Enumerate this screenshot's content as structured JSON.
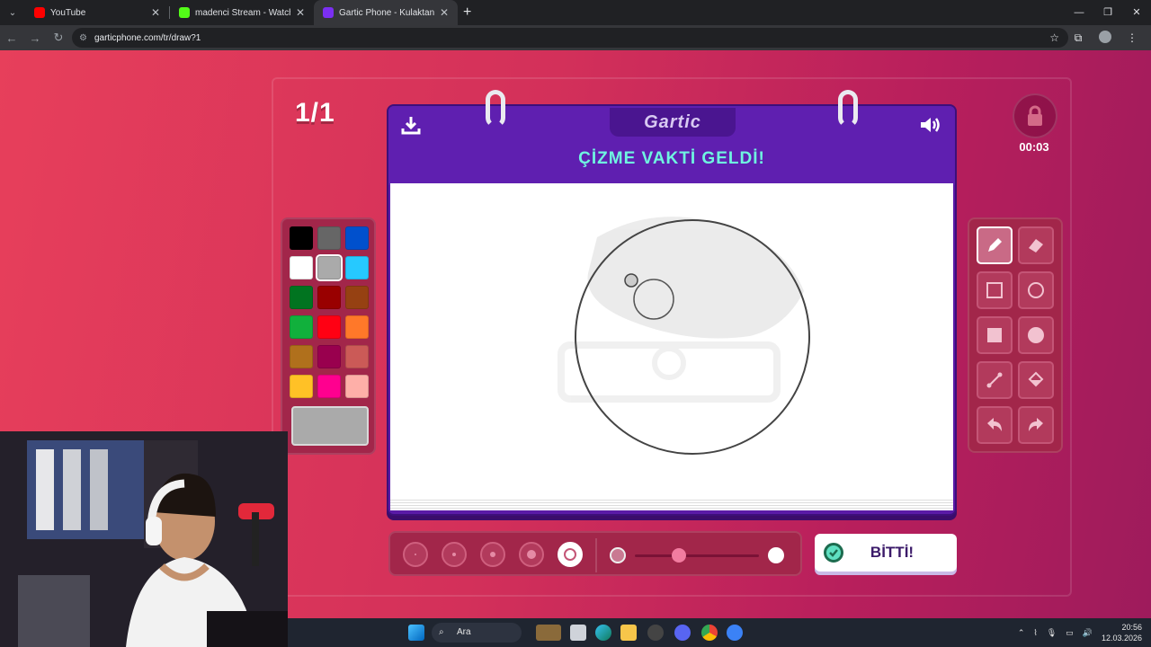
{
  "browser": {
    "tabs": [
      {
        "title": "YouTube",
        "favicon_color": "#ff0000"
      },
      {
        "title": "madenci Stream - Watch Live o",
        "favicon_color": "#53fc18"
      },
      {
        "title": "Gartic Phone - Kulaktan Kulağa",
        "favicon_color": "#7b2ff2"
      }
    ],
    "url": "garticphone.com/tr/draw?1"
  },
  "game": {
    "round": "1/1",
    "timer": "00:03",
    "logo": "Gartic",
    "title": "ÇİZME VAKTİ GELDİ!",
    "done_label": "BİTTİ!",
    "palette": [
      "#000000",
      "#666666",
      "#0050cd",
      "#ffffff",
      "#aaaaaa",
      "#26c9ff",
      "#017420",
      "#990000",
      "#964112",
      "#11b03c",
      "#ff0013",
      "#ff7829",
      "#b0701c",
      "#99004e",
      "#cb5a57",
      "#ffc126",
      "#ff008f",
      "#feafa8"
    ],
    "selected_color": "#aaaaaa",
    "tools": [
      "pencil-tool",
      "eraser-tool",
      "rectangle-outline-tool",
      "circle-outline-tool",
      "rectangle-fill-tool",
      "circle-fill-tool",
      "line-tool",
      "fill-bucket-tool",
      "undo-tool",
      "redo-tool"
    ]
  },
  "taskbar": {
    "search_label": "Ara",
    "time": "20:56",
    "date": "12.03.2026"
  }
}
